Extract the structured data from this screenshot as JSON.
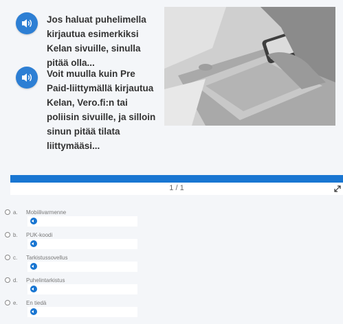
{
  "slide": {
    "audio_items": [
      {
        "text": "Jos haluat puhelimella kirjautua esimerkiksi Kelan sivuille, sinulla pitää olla..."
      },
      {
        "text": "Voit muulla kuin Pre Paid-liittymällä kirjautua Kelan, Vero.fi:n tai poliisin sivuille, ja silloin sinun pitää tilata liittymääsi..."
      }
    ]
  },
  "pager": {
    "text": "1 / 1"
  },
  "options": [
    {
      "letter": "a.",
      "label": "Mobiilivarmenne"
    },
    {
      "letter": "b.",
      "label": "PUK-koodi"
    },
    {
      "letter": "c.",
      "label": "Tarkistussovellus"
    },
    {
      "letter": "d.",
      "label": "Puhelintarkistus"
    },
    {
      "letter": "e.",
      "label": "En tiedä"
    }
  ],
  "colors": {
    "accent": "#1976d2",
    "audio_button": "#2d7fd4",
    "background": "#f4f6f9"
  },
  "icons": {
    "audio": "speaker-icon",
    "expand": "expand-icon",
    "photo": "laptop-phone-photo"
  }
}
